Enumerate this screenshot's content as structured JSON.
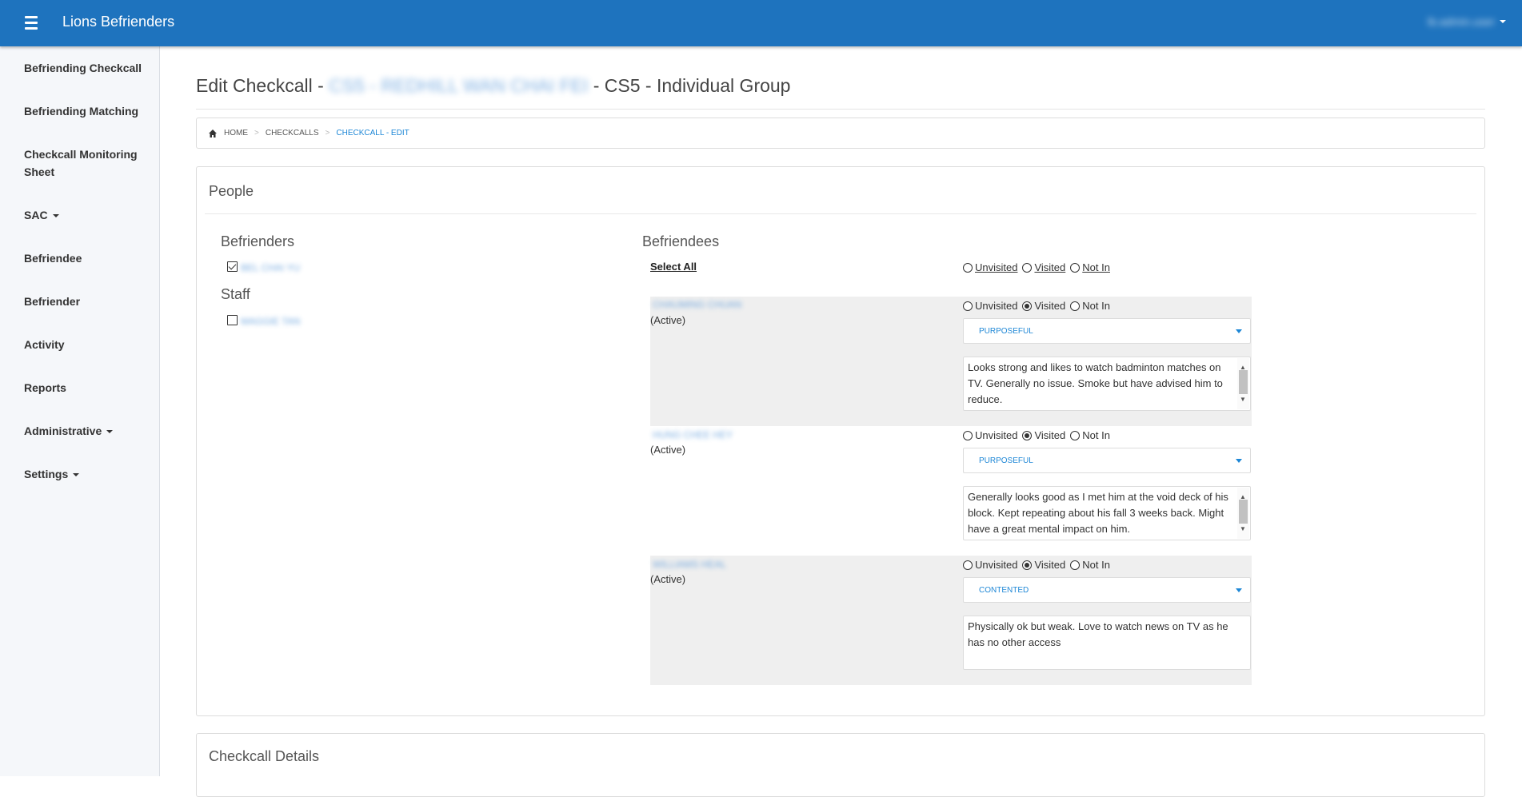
{
  "app": {
    "title": "Lions Befrienders",
    "user_name": "lb.admin.user"
  },
  "sidebar": {
    "items": [
      {
        "label": "Befriending Checkcall",
        "has_caret": false
      },
      {
        "label": "Befriending Matching",
        "has_caret": false
      },
      {
        "label": "Checkcall Monitoring Sheet",
        "has_caret": false
      },
      {
        "label": "SAC",
        "has_caret": true
      },
      {
        "label": "Befriendee",
        "has_caret": false
      },
      {
        "label": "Befriender",
        "has_caret": false
      },
      {
        "label": "Activity",
        "has_caret": false
      },
      {
        "label": "Reports",
        "has_caret": false
      },
      {
        "label": "Administrative",
        "has_caret": true
      },
      {
        "label": "Settings",
        "has_caret": true
      }
    ]
  },
  "page": {
    "title_prefix": "Edit Checkcall -",
    "title_blurred": "CS5 - REDHILL WAN CHAI FEI",
    "title_suffix": "- CS5 - Individual Group"
  },
  "breadcrumb": {
    "home": "Home",
    "checkcalls": "Checkcalls",
    "current": "Checkcall - Edit",
    "separator": ">"
  },
  "people": {
    "panel_title": "People",
    "befrienders_heading": "Befrienders",
    "befriender_name": "BEL CHAI YU",
    "befriender_checked": true,
    "staff_heading": "Staff",
    "staff_name": "MAGGIE TAN",
    "staff_checked": false,
    "befriendees_heading": "Befriendees",
    "select_all": "Select All",
    "radio_labels": {
      "unvisited": "Unvisited",
      "visited": "Visited",
      "not_in": "Not In"
    },
    "befriendees": [
      {
        "name": "CHAUMING CHUAN",
        "status": "(Active)",
        "visit_state": "visited",
        "mood": "PURPOSEFUL",
        "notes": "Looks strong and likes to watch badminton matches on TV. Generally no issue. Smoke but have advised him to reduce."
      },
      {
        "name": "HUNG CHEE HEY",
        "status": "(Active)",
        "visit_state": "visited",
        "mood": "PURPOSEFUL",
        "notes": "Generally looks good as I met him at the void deck of his block. Kept repeating about his fall 3 weeks back. Might have a great mental impact on him."
      },
      {
        "name": "WILLIAMS HEAL",
        "status": "(Active)",
        "visit_state": "visited",
        "mood": "CONTENTED",
        "notes": "Physically ok but weak. Love to watch news on TV as he has no other access"
      }
    ]
  },
  "details": {
    "panel_title": "Checkcall Details"
  },
  "colors": {
    "topbar": "#1e73be",
    "accent": "#1e87d6",
    "row_bg": "#efefef"
  },
  "icons": {
    "menu": "hamburger-icon",
    "home": "home-icon",
    "dropdown": "caret-down-icon"
  }
}
